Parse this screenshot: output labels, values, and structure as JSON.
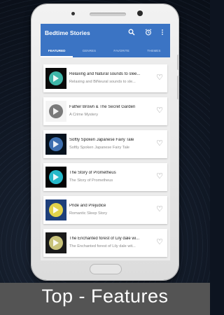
{
  "app": {
    "title": "Bedtime Stories"
  },
  "toolbar": {
    "icons": [
      "search-icon",
      "alarm-icon",
      "more-vert-icon"
    ]
  },
  "tabs": [
    {
      "label": "FEATURED",
      "active": true
    },
    {
      "label": "GENRES",
      "active": false
    },
    {
      "label": "FAVORITE",
      "active": false
    },
    {
      "label": "THEMES",
      "active": false
    }
  ],
  "stories": [
    {
      "title": "Relaxing and Natural sounds to slee...",
      "subtitle": "Relaxing and BiNeural sounds to sle...",
      "thumb_colors": [
        "#0b0b0b",
        "#3fb6a8"
      ]
    },
    {
      "title": "Father Brown & The Secret Garden",
      "subtitle": "A Crime Mystery",
      "thumb_colors": [
        "#f4f4f4",
        "#7a7a7a"
      ]
    },
    {
      "title": "Softly Spoken Japanese Fairy Tale",
      "subtitle": "Softly Spoken Japanese Fairy Tale",
      "thumb_colors": [
        "#06121e",
        "#3e6fb0"
      ]
    },
    {
      "title": "The Story of Prometheus",
      "subtitle": "The Story of Prometheus",
      "thumb_colors": [
        "#050505",
        "#25b8c9"
      ]
    },
    {
      "title": "Pride and Prejudice",
      "subtitle": "Romantic Sleep Story",
      "thumb_colors": [
        "#1e3f7a",
        "#e2d24a"
      ]
    },
    {
      "title": "The Enchanted forest of Lily dale wi...",
      "subtitle": "The Enchanted forest of Lily dale wit...",
      "thumb_colors": [
        "#1a1a1a",
        "#c9c37a"
      ]
    }
  ],
  "caption": "Top - Features"
}
